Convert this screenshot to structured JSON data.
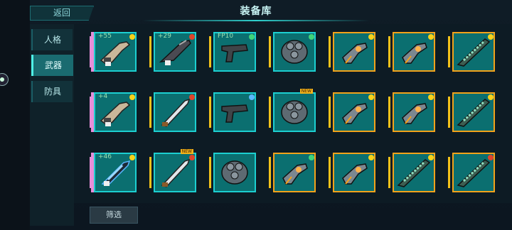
{
  "header": {
    "back_label": "返回",
    "title": "装备库"
  },
  "sidebar": {
    "tabs": [
      {
        "label": "人格"
      },
      {
        "label": "武器"
      },
      {
        "label": "防具"
      }
    ]
  },
  "filter": {
    "label": "筛选"
  },
  "colors": {
    "accent": "#1ccfd0",
    "frame_orange": "#f2a21a",
    "frame_pink": "#e58ed8",
    "bg": "#0c1620"
  },
  "grid": {
    "rows": [
      [
        {
          "type": "rifle-beige",
          "frame": "pink",
          "level": "+55",
          "gem": "yellow"
        },
        {
          "type": "rifle-dark",
          "frame": "cyan",
          "level": "+29",
          "gem": "red",
          "sub": "5"
        },
        {
          "type": "pistol",
          "frame": "cyan",
          "level": "FP10",
          "gem": "green"
        },
        {
          "type": "gauntlet",
          "frame": "cyan",
          "level": "",
          "gem": "green"
        },
        {
          "type": "blaster",
          "frame": "orange",
          "level": "",
          "gem": "yellow"
        },
        {
          "type": "blaster",
          "frame": "orange",
          "level": "",
          "gem": "yellow"
        },
        {
          "type": "blade-rifle",
          "frame": "orange",
          "level": "",
          "gem": "yellow"
        }
      ],
      [
        {
          "type": "rifle-beige",
          "frame": "pink",
          "level": "+4",
          "gem": "yellow"
        },
        {
          "type": "sword",
          "frame": "cyan",
          "level": "",
          "gem": "red"
        },
        {
          "type": "pistol",
          "frame": "cyan",
          "level": "",
          "gem": "blue"
        },
        {
          "type": "gauntlet",
          "frame": "cyan",
          "level": "",
          "gem": "",
          "new": "NEW"
        },
        {
          "type": "blaster",
          "frame": "orange",
          "level": "",
          "gem": "yellow"
        },
        {
          "type": "blaster",
          "frame": "orange",
          "level": "",
          "gem": "yellow"
        },
        {
          "type": "blade-rifle",
          "frame": "orange",
          "level": "",
          "gem": "yellow"
        }
      ],
      [
        {
          "type": "crystal-gun",
          "frame": "pink",
          "level": "+46",
          "gem": "yellow"
        },
        {
          "type": "sword",
          "frame": "cyan",
          "level": "",
          "gem": "red",
          "new": "NEW"
        },
        {
          "type": "gauntlet",
          "frame": "cyan",
          "level": "",
          "gem": ""
        },
        {
          "type": "blaster",
          "frame": "orange",
          "level": "",
          "gem": "green"
        },
        {
          "type": "blaster",
          "frame": "orange",
          "level": "",
          "gem": "yellow"
        },
        {
          "type": "blade-rifle",
          "frame": "orange",
          "level": "",
          "gem": "yellow"
        },
        {
          "type": "blade-rifle",
          "frame": "orange",
          "level": "",
          "gem": "red"
        }
      ]
    ]
  }
}
